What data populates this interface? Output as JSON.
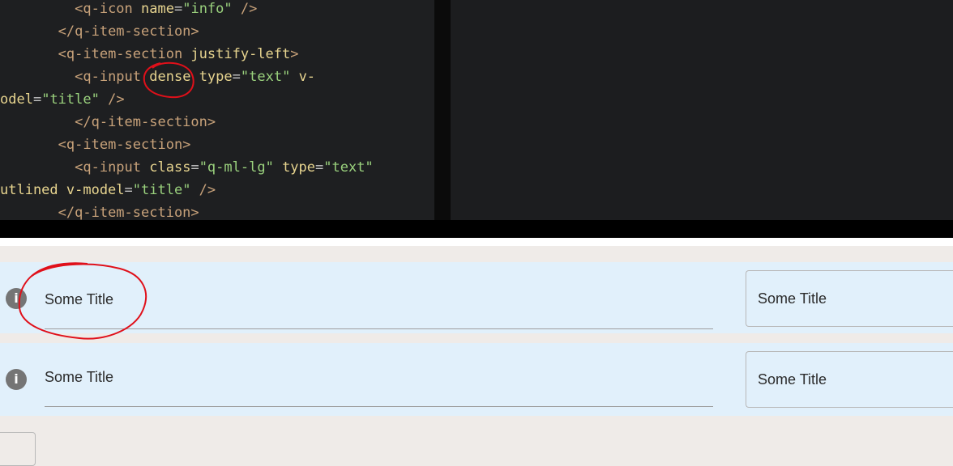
{
  "editor": {
    "lines": [
      {
        "indent": "         ",
        "parts": [
          {
            "t": "tag",
            "v": "<q-icon "
          },
          {
            "t": "attr",
            "v": "name"
          },
          {
            "t": "eq",
            "v": "="
          },
          {
            "t": "str",
            "v": "\"info\""
          },
          {
            "t": "tag",
            "v": " />"
          }
        ]
      },
      {
        "indent": "       ",
        "parts": [
          {
            "t": "tag",
            "v": "</q-item-section>"
          }
        ]
      },
      {
        "indent": "       ",
        "parts": [
          {
            "t": "tag",
            "v": "<q-item-section "
          },
          {
            "t": "dir",
            "v": "justify-left"
          },
          {
            "t": "tag",
            "v": ">"
          }
        ]
      },
      {
        "indent": "         ",
        "parts": [
          {
            "t": "tag",
            "v": "<q-input "
          },
          {
            "t": "attr",
            "v": "dense"
          },
          {
            "t": "tag",
            "v": " "
          },
          {
            "t": "attr",
            "v": "type"
          },
          {
            "t": "eq",
            "v": "="
          },
          {
            "t": "str",
            "v": "\"text\""
          },
          {
            "t": "tag",
            "v": " "
          },
          {
            "t": "attr",
            "v": "v-"
          }
        ]
      },
      {
        "indent": "",
        "parts": [
          {
            "t": "attr",
            "v": "odel"
          },
          {
            "t": "eq",
            "v": "="
          },
          {
            "t": "str",
            "v": "\"title\""
          },
          {
            "t": "tag",
            "v": " />"
          }
        ]
      },
      {
        "indent": "         ",
        "parts": [
          {
            "t": "tag",
            "v": "</q-item-section>"
          }
        ]
      },
      {
        "indent": "       ",
        "parts": [
          {
            "t": "tag",
            "v": "<q-item-section>"
          }
        ]
      },
      {
        "indent": "         ",
        "parts": [
          {
            "t": "tag",
            "v": "<q-input "
          },
          {
            "t": "attr",
            "v": "class"
          },
          {
            "t": "eq",
            "v": "="
          },
          {
            "t": "str",
            "v": "\"q-ml-lg\""
          },
          {
            "t": "tag",
            "v": " "
          },
          {
            "t": "attr",
            "v": "type"
          },
          {
            "t": "eq",
            "v": "="
          },
          {
            "t": "str",
            "v": "\"text\""
          }
        ]
      },
      {
        "indent": "",
        "parts": [
          {
            "t": "attr",
            "v": "utlined v-model"
          },
          {
            "t": "eq",
            "v": "="
          },
          {
            "t": "str",
            "v": "\"title\""
          },
          {
            "t": "tag",
            "v": " />"
          }
        ]
      },
      {
        "indent": "       ",
        "parts": [
          {
            "t": "tag",
            "v": "</q-item-section>"
          }
        ]
      }
    ]
  },
  "form": {
    "row1": {
      "icon": "info-icon",
      "icon_glyph": "i",
      "dense_value": "Some Title",
      "outlined_value": "Some Title"
    },
    "row2": {
      "icon": "info-icon",
      "icon_glyph": "i",
      "dense_value": "Some Title",
      "outlined_value": "Some Title"
    }
  },
  "annotation_color": "#e0101a"
}
